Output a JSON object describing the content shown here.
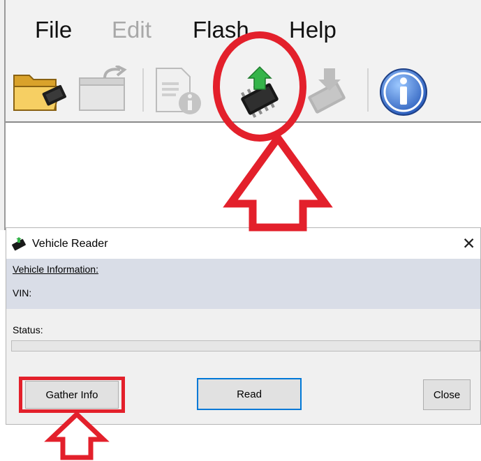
{
  "menu": {
    "file": "File",
    "edit": "Edit",
    "flash": "Flash",
    "help": "Help"
  },
  "toolbar": {
    "buttons": [
      {
        "name": "open-folder-icon",
        "enabled": true
      },
      {
        "name": "export-icon",
        "enabled": false
      },
      {
        "name": "file-info-icon",
        "enabled": false
      },
      {
        "name": "chip-upload-icon",
        "enabled": true
      },
      {
        "name": "chip-download-icon",
        "enabled": false
      },
      {
        "name": "info-icon",
        "enabled": true
      }
    ]
  },
  "dialog": {
    "title": "Vehicle Reader",
    "close_glyph": "✕",
    "info_heading": "Vehicle Information:",
    "vin_label": "VIN:",
    "vin_value": "",
    "status_label": "Status:",
    "progress": 0,
    "buttons": {
      "gather": "Gather Info",
      "read": "Read",
      "close": "Close"
    }
  },
  "colors": {
    "annotation": "#e3202b",
    "default_button_border": "#0078d7",
    "info_panel": "#d9dde7",
    "chip_arrow": "#35b44a"
  }
}
